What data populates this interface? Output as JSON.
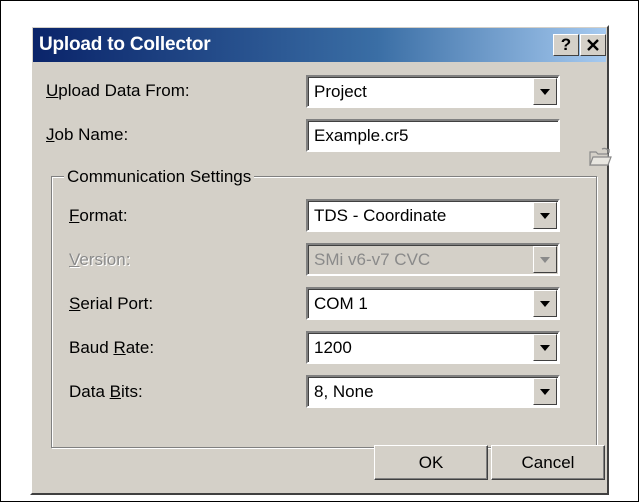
{
  "dialog": {
    "title": "Upload to Collector",
    "help_button": "?",
    "close_button": "x"
  },
  "upload_from": {
    "label_hotkey": "U",
    "label_rest": "pload Data From:",
    "value": "Project"
  },
  "job_name": {
    "label_hotkey": "J",
    "label_rest": "ob Name:",
    "value": "Example.cr5",
    "browse_icon": "folder-open-icon"
  },
  "communication": {
    "group_title": "Communication Settings",
    "format": {
      "label_hotkey": "F",
      "label_rest": "ormat:",
      "value": "TDS - Coordinate"
    },
    "version": {
      "label_hotkey": "V",
      "label_rest": "ersion:",
      "value": "SMi v6-v7 CVC",
      "enabled": false
    },
    "serial_port": {
      "label_hotkey": "S",
      "label_rest": "erial Port:",
      "value": "COM 1"
    },
    "baud_rate": {
      "label_prefix": "Baud ",
      "label_hotkey": "R",
      "label_rest": "ate:",
      "value": "1200"
    },
    "data_bits": {
      "label_prefix": "Data ",
      "label_hotkey": "B",
      "label_rest": "its:",
      "value": "8, None"
    }
  },
  "buttons": {
    "ok": "OK",
    "cancel": "Cancel"
  },
  "colors": {
    "title_bar_start": "#0a246a",
    "title_bar_end": "#a6caf0",
    "dialog_face": "#d4d0c8",
    "disabled_text": "#8a8a8a"
  }
}
